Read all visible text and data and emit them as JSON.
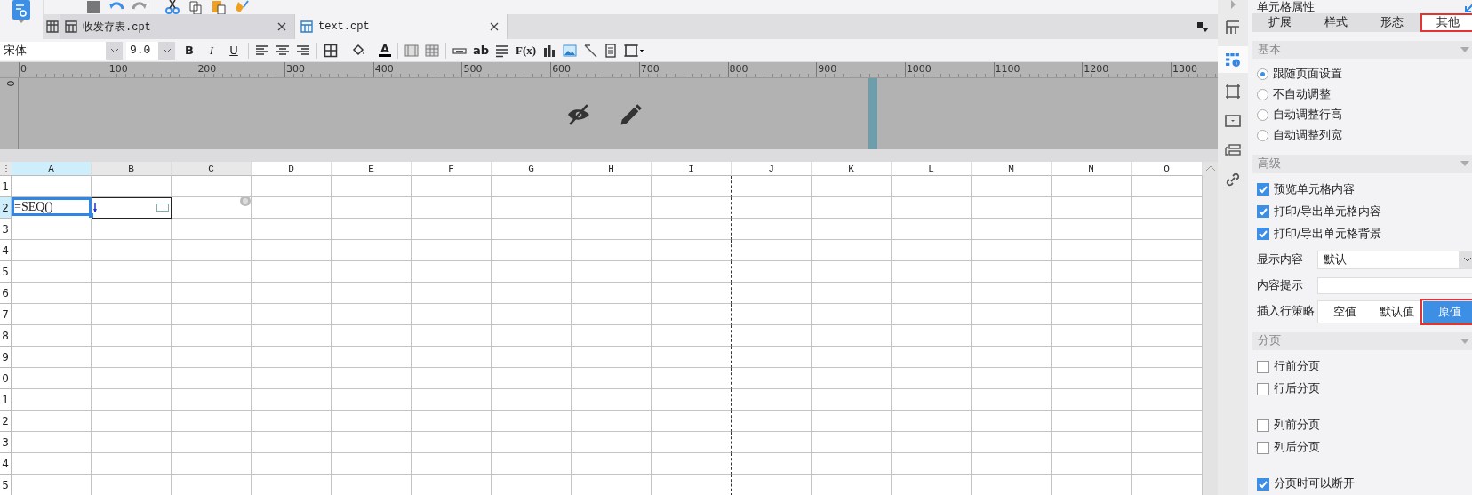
{
  "panel_title": "单元格属性",
  "doc_tabs": [
    {
      "label": "收发存表.cpt",
      "selected": false
    },
    {
      "label": "text.cpt",
      "selected": true
    }
  ],
  "format_toolbar": {
    "font": "宋体",
    "size": "9.0",
    "items": [
      {
        "kind": "bold",
        "label": "B"
      },
      {
        "kind": "italic",
        "label": "I"
      },
      {
        "kind": "underline",
        "label": "U"
      },
      {
        "kind": "sep"
      },
      {
        "kind": "align-left"
      },
      {
        "kind": "align-center"
      },
      {
        "kind": "align-right"
      },
      {
        "kind": "sep"
      },
      {
        "kind": "border"
      },
      {
        "kind": "fill"
      },
      {
        "kind": "font-color",
        "label": "A"
      },
      {
        "kind": "sep"
      },
      {
        "kind": "merge"
      },
      {
        "kind": "unmerge"
      },
      {
        "kind": "sep"
      },
      {
        "kind": "field"
      },
      {
        "kind": "text",
        "label": "ab"
      },
      {
        "kind": "wrap"
      },
      {
        "kind": "formula",
        "label": "F(x)"
      },
      {
        "kind": "chart"
      },
      {
        "kind": "image"
      },
      {
        "kind": "slash"
      },
      {
        "kind": "subreport"
      },
      {
        "kind": "frame"
      }
    ]
  },
  "vertical_ruler": "0",
  "ruler": {
    "ticks": [
      "0",
      "100",
      "200",
      "300",
      "400",
      "500",
      "600",
      "700",
      "800",
      "900",
      "1000",
      "1100",
      "1200",
      "1300"
    ]
  },
  "grid": {
    "columns": [
      {
        "label": "A",
        "selected": true,
        "page_break": false
      },
      {
        "label": "B",
        "selected": false,
        "page_break": false
      },
      {
        "label": "C",
        "selected": false,
        "page_break": false
      },
      {
        "label": "D",
        "selected": false,
        "page_break": false
      },
      {
        "label": "E",
        "selected": false,
        "page_break": false
      },
      {
        "label": "F",
        "selected": false,
        "page_break": false
      },
      {
        "label": "G",
        "selected": false,
        "page_break": false
      },
      {
        "label": "H",
        "selected": false,
        "page_break": false
      },
      {
        "label": "I",
        "selected": false,
        "page_break": true
      },
      {
        "label": "J",
        "selected": false,
        "page_break": false
      },
      {
        "label": "K",
        "selected": false,
        "page_break": false
      },
      {
        "label": "L",
        "selected": false,
        "page_break": false
      },
      {
        "label": "M",
        "selected": false,
        "page_break": false
      },
      {
        "label": "N",
        "selected": false,
        "page_break": false
      },
      {
        "label": "O",
        "selected": false,
        "page_break": false
      }
    ],
    "rows": [
      {
        "label": "1",
        "selected": false
      },
      {
        "label": "2",
        "selected": true,
        "cells": [
          {
            "text": "=SEQ()",
            "selected": true
          },
          {
            "selected": false
          }
        ]
      },
      {
        "label": "3",
        "selected": false
      },
      {
        "label": "4",
        "selected": false
      },
      {
        "label": "5",
        "selected": false
      },
      {
        "label": "6",
        "selected": false
      },
      {
        "label": "7",
        "selected": false
      },
      {
        "label": "8",
        "selected": false
      },
      {
        "label": "9",
        "selected": false
      },
      {
        "label": "0",
        "selected": false
      },
      {
        "label": "1",
        "selected": false
      },
      {
        "label": "2",
        "selected": false
      },
      {
        "label": "3",
        "selected": false
      },
      {
        "label": "4",
        "selected": false
      },
      {
        "label": "5",
        "selected": false
      }
    ]
  },
  "panel_tabs": [
    {
      "label": "扩展",
      "selected": false
    },
    {
      "label": "样式",
      "selected": false
    },
    {
      "label": "形态",
      "selected": false
    },
    {
      "label": "其他",
      "selected": true
    }
  ],
  "sections": [
    {
      "title": "基本",
      "groups": [
        [
          {
            "kind": "radio",
            "label": "跟随页面设置",
            "selected": true
          },
          {
            "kind": "radio",
            "label": "不自动调整",
            "selected": false
          },
          {
            "kind": "radio",
            "label": "自动调整行高",
            "selected": false
          },
          {
            "kind": "radio",
            "label": "自动调整列宽",
            "selected": false
          }
        ]
      ]
    },
    {
      "title": "高级",
      "groups": [
        [
          {
            "kind": "checkbox",
            "label": "预览单元格内容",
            "checked": true
          },
          {
            "kind": "checkbox",
            "label": "打印/导出单元格内容",
            "checked": true
          },
          {
            "kind": "checkbox",
            "label": "打印/导出单元格背景",
            "checked": true
          },
          {
            "kind": "select",
            "label": "显示内容",
            "value": "默认"
          },
          {
            "kind": "input",
            "label": "内容提示"
          },
          {
            "kind": "segmented",
            "label": "插入行策略",
            "options": [
              {
                "label": "空值",
                "selected": false
              },
              {
                "label": "默认值",
                "selected": false
              },
              {
                "label": "原值",
                "selected": true
              }
            ]
          }
        ]
      ]
    },
    {
      "title": "分页",
      "groups": [
        [
          {
            "kind": "checkbox",
            "label": "行前分页",
            "checked": false
          },
          {
            "kind": "checkbox",
            "label": "行后分页",
            "checked": false
          }
        ],
        [
          {
            "kind": "checkbox",
            "label": "列前分页",
            "checked": false
          },
          {
            "kind": "checkbox",
            "label": "列后分页",
            "checked": false
          }
        ],
        [
          {
            "kind": "checkbox",
            "label": "分页时可以断开",
            "checked": true
          }
        ]
      ]
    }
  ]
}
